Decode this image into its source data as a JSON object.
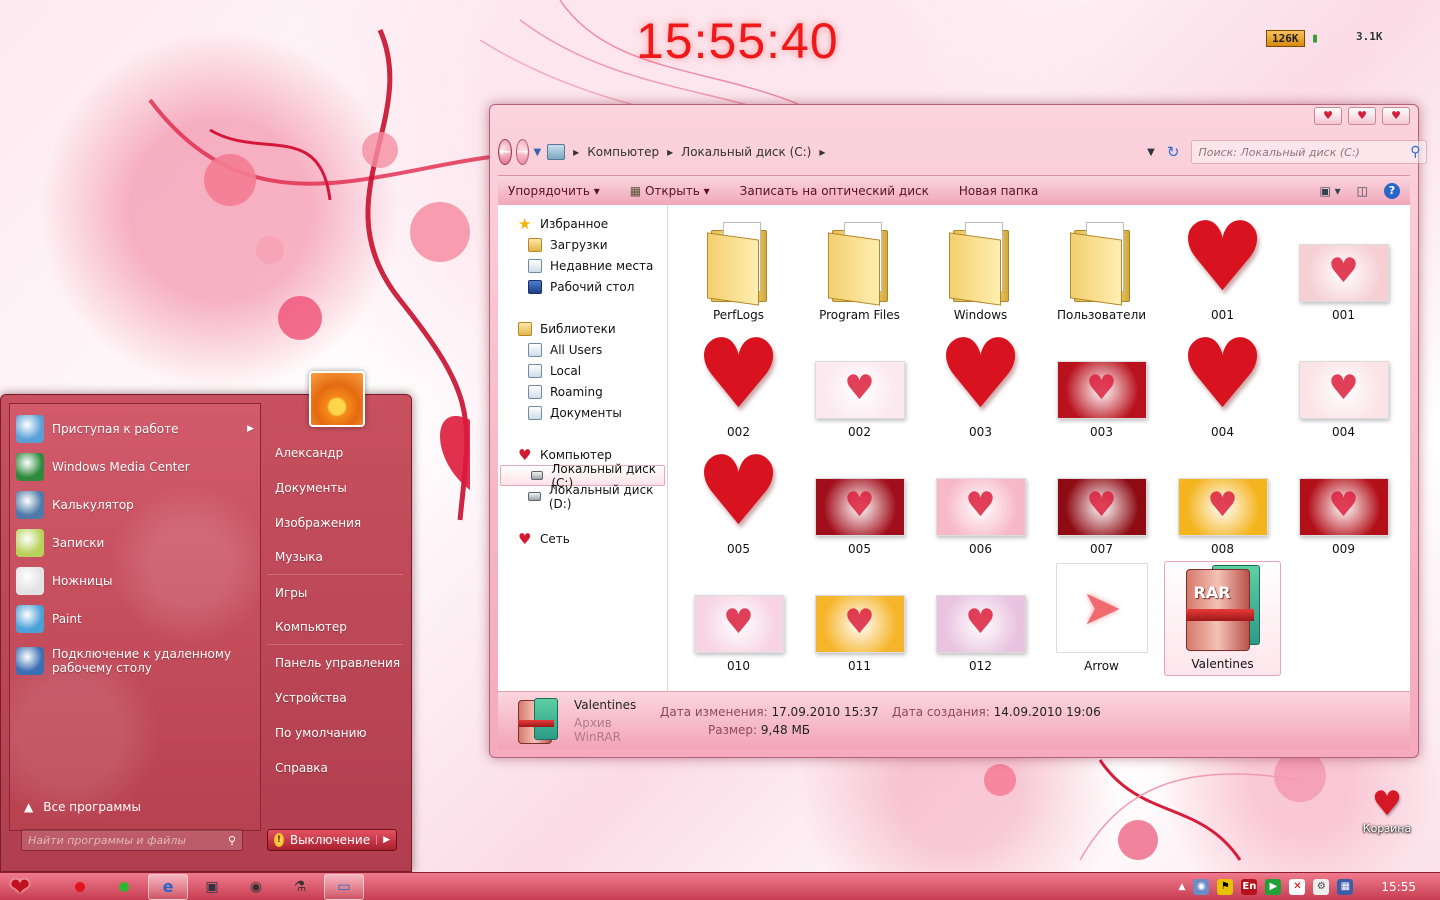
{
  "desktop": {
    "clock": "15:55:40",
    "meters": [
      {
        "bar": "126K",
        "text": ""
      },
      {
        "bar": "",
        "text": "3.1K"
      }
    ],
    "recycle_bin": "Корзина"
  },
  "explorer": {
    "window_buttons": [
      "♥",
      "♥",
      "♥"
    ],
    "breadcrumb": [
      "Компьютер",
      "Локальный диск (C:)"
    ],
    "search_placeholder": "Поиск: Локальный диск (C:)",
    "toolbar": {
      "organize": "Упорядочить",
      "open": "Открыть",
      "burn": "Записать на оптический диск",
      "new_folder": "Новая папка"
    },
    "sidebar": [
      {
        "label": "Избранное",
        "icon": "star",
        "sub": false
      },
      {
        "label": "Загрузки",
        "icon": "folder",
        "sub": true
      },
      {
        "label": "Недавние места",
        "icon": "lib",
        "sub": true
      },
      {
        "label": "Рабочий стол",
        "icon": "desk",
        "sub": true
      },
      {
        "gap": true
      },
      {
        "label": "Библиотеки",
        "icon": "folder",
        "sub": false
      },
      {
        "label": "All Users",
        "icon": "lib",
        "sub": true
      },
      {
        "label": "Local",
        "icon": "lib",
        "sub": true
      },
      {
        "label": "Roaming",
        "icon": "lib",
        "sub": true
      },
      {
        "label": "Документы",
        "icon": "lib",
        "sub": true
      },
      {
        "gap": true
      },
      {
        "label": "Компьютер",
        "icon": "heart",
        "sub": false
      },
      {
        "label": "Локальный диск (C:)",
        "icon": "drive",
        "sub": true,
        "selected": true
      },
      {
        "label": "Локальный диск (D:)",
        "icon": "drive",
        "sub": true
      },
      {
        "gap": true
      },
      {
        "label": "Сеть",
        "icon": "heart",
        "sub": false
      }
    ],
    "files": [
      {
        "name": "PerfLogs",
        "kind": "folder"
      },
      {
        "name": "Program Files",
        "kind": "folder"
      },
      {
        "name": "Windows",
        "kind": "folder"
      },
      {
        "name": "Пользователи",
        "kind": "folder"
      },
      {
        "name": "001",
        "kind": "heart"
      },
      {
        "name": "001",
        "kind": "thumb",
        "bg": "#f6cfd3"
      },
      {
        "name": "002",
        "kind": "heart"
      },
      {
        "name": "002",
        "kind": "thumb",
        "bg": "#fbe9ef"
      },
      {
        "name": "003",
        "kind": "heart"
      },
      {
        "name": "003",
        "kind": "thumb",
        "bg": "#b9111d"
      },
      {
        "name": "004",
        "kind": "heart"
      },
      {
        "name": "004",
        "kind": "thumb",
        "bg": "#fbe4e6"
      },
      {
        "name": "005",
        "kind": "heart"
      },
      {
        "name": "005",
        "kind": "thumb",
        "bg": "#a10e1b"
      },
      {
        "name": "006",
        "kind": "thumb",
        "bg": "#f7b8c8"
      },
      {
        "name": "007",
        "kind": "thumb",
        "bg": "#8e0b14"
      },
      {
        "name": "008",
        "kind": "thumb",
        "bg": "#f4b41e"
      },
      {
        "name": "009",
        "kind": "thumb",
        "bg": "#b30f19"
      },
      {
        "name": "010",
        "kind": "thumb",
        "bg": "#f7d4e4"
      },
      {
        "name": "011",
        "kind": "thumb",
        "bg": "#f6b52b"
      },
      {
        "name": "012",
        "kind": "thumb",
        "bg": "#e9c4e0"
      },
      {
        "name": "Arrow",
        "kind": "arrow"
      },
      {
        "name": "Valentines",
        "kind": "rar",
        "selected": true
      }
    ],
    "details": {
      "name": "Valentines",
      "type": "Архив WinRAR",
      "modified_label": "Дата изменения:",
      "modified": "17.09.2010 15:37",
      "size_label": "Размер:",
      "size": "9,48 МБ",
      "created_label": "Дата создания:",
      "created": "14.09.2010 19:06"
    }
  },
  "start_menu": {
    "programs": [
      {
        "label": "Приступая к работе",
        "color": "#5b9fd6",
        "arrow": true
      },
      {
        "label": "Windows Media Center",
        "color": "#2e8a3c"
      },
      {
        "label": "Калькулятор",
        "color": "#4e79a8"
      },
      {
        "label": "Записки",
        "color": "#b8d35c"
      },
      {
        "label": "Ножницы",
        "color": "#e3e3e3"
      },
      {
        "label": "Paint",
        "color": "#4ba0d8"
      },
      {
        "label": "Подключение к удаленному рабочему столу",
        "color": "#3a6fb4",
        "tall": true
      }
    ],
    "all_programs": "Все программы",
    "search_placeholder": "Найти программы и файлы",
    "right": [
      {
        "label": "Александр"
      },
      {
        "label": "Документы"
      },
      {
        "label": "Изображения"
      },
      {
        "label": "Музыка",
        "divider": true
      },
      {
        "label": "Игры"
      },
      {
        "label": "Компьютер",
        "divider": true
      },
      {
        "label": "Панель управления"
      },
      {
        "label": "Устройства"
      },
      {
        "label": "По умолчанию"
      },
      {
        "label": "Справка"
      }
    ],
    "shutdown": "Выключение"
  },
  "taskbar": {
    "time": "15:55",
    "lang": "En"
  }
}
